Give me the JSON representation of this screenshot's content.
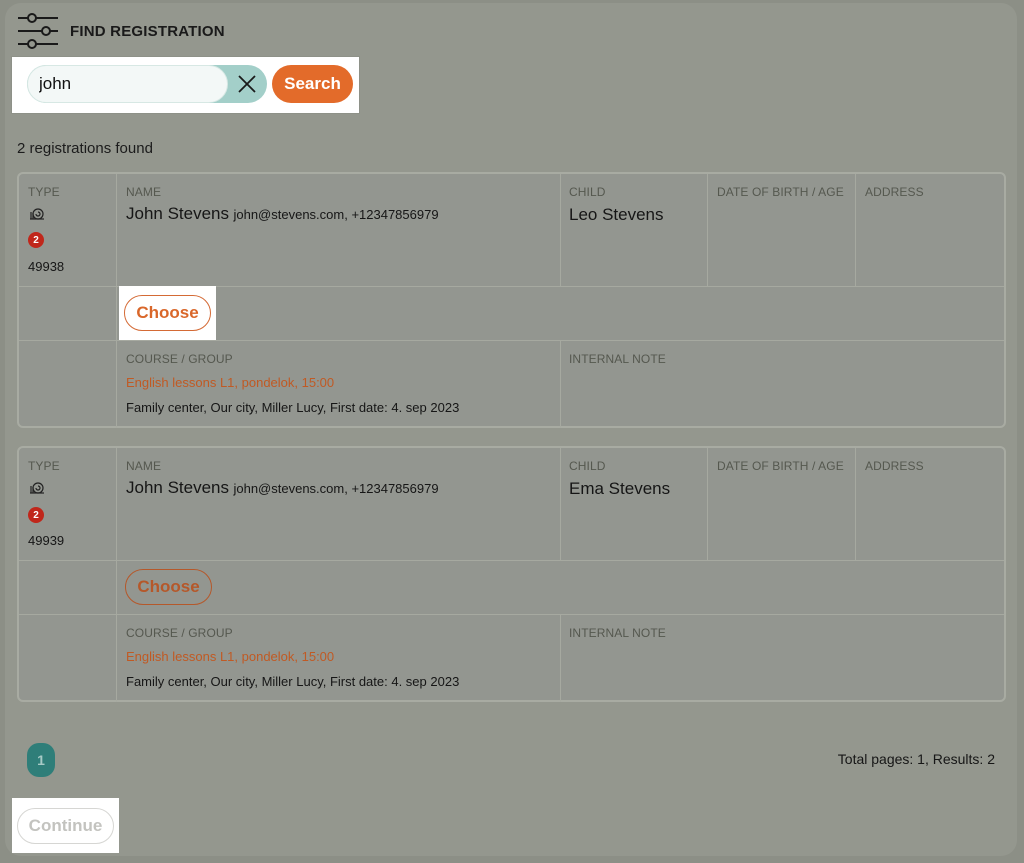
{
  "header": {
    "title": "FIND REGISTRATION",
    "icon": "sliders-icon"
  },
  "search": {
    "value": "john",
    "placeholder": "",
    "button_label": "Search",
    "clear_icon": "close-icon"
  },
  "results_text": "2 registrations found",
  "columns": {
    "type": "TYPE",
    "name": "NAME",
    "child": "CHILD",
    "dob": "DATE OF BIRTH / AGE",
    "address": "ADDRESS",
    "course": "COURSE / GROUP",
    "note": "INTERNAL NOTE"
  },
  "registrations": [
    {
      "type_icon": "snail-icon",
      "badge": "2",
      "id": "49938",
      "name": "John Stevens",
      "contact": "john@stevens.com, +12347856979",
      "child": "Leo Stevens",
      "dob": "",
      "address": "",
      "choose_label": "Choose",
      "course": "English lessons L1, pondelok, 15:00",
      "course_detail": "Family center, Our city, Miller Lucy, First date: 4. sep 2023",
      "note": ""
    },
    {
      "type_icon": "snail-icon",
      "badge": "2",
      "id": "49939",
      "name": "John Stevens",
      "contact": "john@stevens.com, +12347856979",
      "child": "Ema Stevens",
      "dob": "",
      "address": "",
      "choose_label": "Choose",
      "course": "English lessons L1, pondelok, 15:00",
      "course_detail": "Family center, Our city, Miller Lucy, First date: 4. sep 2023",
      "note": ""
    }
  ],
  "pagination": {
    "current_page": "1",
    "totals": "Total pages: 1, Results: 2"
  },
  "footer": {
    "continue_label": "Continue"
  },
  "colors": {
    "accent": "#e36b2a",
    "teal": "#2f7e79",
    "badge": "#c0271b"
  }
}
